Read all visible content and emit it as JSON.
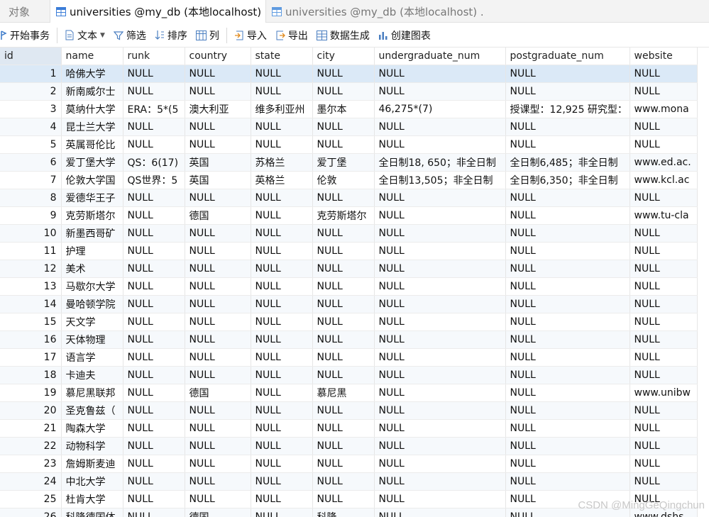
{
  "tabs": {
    "objects_label": "对象",
    "active_label": "universities @my_db (本地localhost) ...",
    "inactive_label": "universities @my_db (本地localhost) ..."
  },
  "toolbar": {
    "begin_transaction": "开始事务",
    "text": "文本",
    "filter": "筛选",
    "sort": "排序",
    "columns": "列",
    "import": "导入",
    "export": "导出",
    "data_generation": "数据生成",
    "create_chart": "创建图表"
  },
  "table": {
    "columns": [
      "id",
      "name",
      "runk",
      "country",
      "state",
      "city",
      "undergraduate_num",
      "postgraduate_num",
      "website"
    ],
    "rows": [
      [
        "1",
        "哈佛大学",
        "NULL",
        "NULL",
        "NULL",
        "NULL",
        "NULL",
        "NULL",
        "NULL"
      ],
      [
        "2",
        "新南威尔士",
        "NULL",
        "NULL",
        "NULL",
        "NULL",
        "NULL",
        "NULL",
        "NULL"
      ],
      [
        "3",
        "莫纳什大学",
        "ERA：5*(5",
        "澳大利亚",
        "维多利亚州",
        "墨尔本",
        "46,275*(7)",
        "授课型：12,925 研究型：",
        "www.mona"
      ],
      [
        "4",
        "昆士兰大学",
        "NULL",
        "NULL",
        "NULL",
        "NULL",
        "NULL",
        "NULL",
        "NULL"
      ],
      [
        "5",
        "英属哥伦比",
        "NULL",
        "NULL",
        "NULL",
        "NULL",
        "NULL",
        "NULL",
        "NULL"
      ],
      [
        "6",
        "爱丁堡大学",
        "QS：6(17)",
        "英国",
        "苏格兰",
        "爱丁堡",
        "全日制18, 650；非全日制",
        "全日制6,485；非全日制",
        "www.ed.ac."
      ],
      [
        "7",
        "伦敦大学国",
        "QS世界：5",
        "英国",
        "英格兰",
        "伦敦",
        "全日制13,505；非全日制",
        "全日制6,350；非全日制",
        "www.kcl.ac"
      ],
      [
        "8",
        "爱德华王子",
        "NULL",
        "NULL",
        "NULL",
        "NULL",
        "NULL",
        "NULL",
        "NULL"
      ],
      [
        "9",
        "克劳斯塔尔",
        "NULL",
        "德国",
        "NULL",
        "克劳斯塔尔",
        "NULL",
        "NULL",
        "www.tu-cla"
      ],
      [
        "10",
        "新墨西哥矿",
        "NULL",
        "NULL",
        "NULL",
        "NULL",
        "NULL",
        "NULL",
        "NULL"
      ],
      [
        "11",
        "护理",
        "NULL",
        "NULL",
        "NULL",
        "NULL",
        "NULL",
        "NULL",
        "NULL"
      ],
      [
        "12",
        "美术",
        "NULL",
        "NULL",
        "NULL",
        "NULL",
        "NULL",
        "NULL",
        "NULL"
      ],
      [
        "13",
        "马歇尔大学",
        "NULL",
        "NULL",
        "NULL",
        "NULL",
        "NULL",
        "NULL",
        "NULL"
      ],
      [
        "14",
        "曼哈顿学院",
        "NULL",
        "NULL",
        "NULL",
        "NULL",
        "NULL",
        "NULL",
        "NULL"
      ],
      [
        "15",
        "天文学",
        "NULL",
        "NULL",
        "NULL",
        "NULL",
        "NULL",
        "NULL",
        "NULL"
      ],
      [
        "16",
        "天体物理",
        "NULL",
        "NULL",
        "NULL",
        "NULL",
        "NULL",
        "NULL",
        "NULL"
      ],
      [
        "17",
        "语言学",
        "NULL",
        "NULL",
        "NULL",
        "NULL",
        "NULL",
        "NULL",
        "NULL"
      ],
      [
        "18",
        "卡迪夫",
        "NULL",
        "NULL",
        "NULL",
        "NULL",
        "NULL",
        "NULL",
        "NULL"
      ],
      [
        "19",
        "慕尼黑联邦",
        "NULL",
        "德国",
        "NULL",
        "慕尼黑",
        "NULL",
        "NULL",
        "www.unibw"
      ],
      [
        "20",
        "圣克鲁兹（",
        "NULL",
        "NULL",
        "NULL",
        "NULL",
        "NULL",
        "NULL",
        "NULL"
      ],
      [
        "21",
        "陶森大学",
        "NULL",
        "NULL",
        "NULL",
        "NULL",
        "NULL",
        "NULL",
        "NULL"
      ],
      [
        "22",
        "动物科学",
        "NULL",
        "NULL",
        "NULL",
        "NULL",
        "NULL",
        "NULL",
        "NULL"
      ],
      [
        "23",
        "詹姆斯麦迪",
        "NULL",
        "NULL",
        "NULL",
        "NULL",
        "NULL",
        "NULL",
        "NULL"
      ],
      [
        "24",
        "中北大学",
        "NULL",
        "NULL",
        "NULL",
        "NULL",
        "NULL",
        "NULL",
        "NULL"
      ],
      [
        "25",
        "杜肯大学",
        "NULL",
        "NULL",
        "NULL",
        "NULL",
        "NULL",
        "NULL",
        "NULL"
      ],
      [
        "26",
        "科隆德国体",
        "NULL",
        "德国",
        "NULL",
        "科隆",
        "NULL",
        "NULL",
        "www.dshs."
      ]
    ]
  },
  "watermark": "CSDN @MingGeQingchun",
  "colors": {
    "selected_row": "#dbe9f7",
    "alt_row": "#f6f9fc",
    "tab_bar": "#f3f3f3"
  }
}
